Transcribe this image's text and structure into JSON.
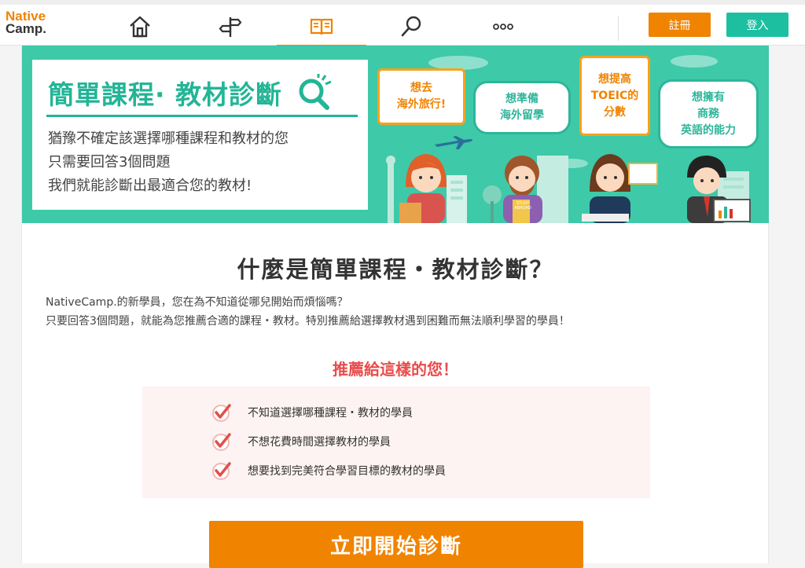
{
  "header": {
    "logo_line1": "Native",
    "logo_line2": "Camp.",
    "nav": [
      {
        "icon": "home-icon"
      },
      {
        "icon": "signpost-icon"
      },
      {
        "icon": "book-icon",
        "active": true
      },
      {
        "icon": "search-icon"
      },
      {
        "icon": "more-icon"
      }
    ],
    "register_label": "註冊",
    "login_label": "登入"
  },
  "banner": {
    "title": "簡單課程· 教材診斷",
    "lines": [
      "猶豫不確定該選擇哪種課程和教材的您",
      "只需要回答3個問題",
      "我們就能診斷出最適合您的教材!"
    ],
    "bubbles": [
      {
        "lines": [
          "想去",
          "海外旅行!"
        ]
      },
      {
        "lines": [
          "想準備",
          "海外留學"
        ]
      },
      {
        "lines": [
          "想提高",
          "TOEIC的",
          "分數"
        ]
      },
      {
        "lines": [
          "想擁有",
          "商務",
          "英語的能力"
        ]
      }
    ],
    "book_label": "STUDY ABROAD"
  },
  "main": {
    "title": "什麼是簡單課程・教材診斷？",
    "intro": [
      "NativeCamp.的新學員，您在為不知道從哪兒開始而煩惱嗎？",
      "只要回答3個問題，就能為您推薦合適的課程・教材。特別推薦給選擇教材遇到困難而無法順利學習的學員！"
    ],
    "recommend_title": "推薦給這樣的您！",
    "recommend_items": [
      "不知道選擇哪種課程・教材的學員",
      "不想花費時間選擇教材的學員",
      "想要找到完美符合學習目標的教材的學員"
    ],
    "cta_label": "立即開始診斷"
  },
  "colors": {
    "brand_orange": "#f08300",
    "teal": "#3ec9a9",
    "accent_red": "#e94c4c"
  }
}
